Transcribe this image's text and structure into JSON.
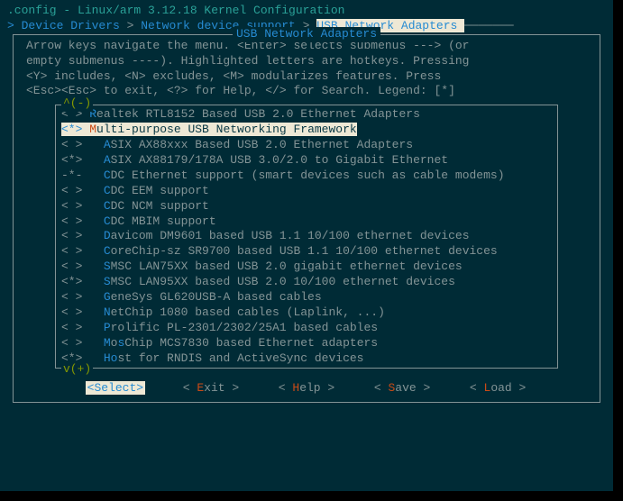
{
  "title": ".config - Linux/arm 3.12.18 Kernel Configuration",
  "breadcrumb": {
    "prefix": "> ",
    "p1": "Device Drivers",
    "p2": "Network device support",
    "p3": "USB Network Adapters",
    "sep": " > "
  },
  "box_title": "USB Network Adapters",
  "help": {
    "l1": "Arrow keys navigate the menu.  <Enter> selects submenus ---> (or",
    "l2": "empty submenus ----).  Highlighted letters are hotkeys.  Pressing",
    "l3": "<Y> includes, <N> excludes, <M> modularizes features.  Press",
    "l4": "<Esc><Esc> to exit, <?> for Help, </> for Search.  Legend: [*]"
  },
  "scroll": {
    "up": "^(-)",
    "down": "v(+)"
  },
  "items": [
    {
      "state": "< >",
      "hot": "R",
      "rest": "ealtek RTL8152 Based USB 2.0 Ethernet Adapters",
      "sel": false,
      "ind": 0
    },
    {
      "state": "<*>",
      "hot": "M",
      "rest": "ulti-purpose USB Networking Framework",
      "sel": true,
      "ind": 0
    },
    {
      "state": "< >",
      "hot": "A",
      "rest": "SIX AX88xxx Based USB 2.0 Ethernet Adapters",
      "sel": false,
      "ind": 1
    },
    {
      "state": "<*>",
      "hot": "A",
      "rest": "SIX AX88179/178A USB 3.0/2.0 to Gigabit Ethernet",
      "sel": false,
      "ind": 1
    },
    {
      "state": "-*-",
      "hot": "C",
      "rest": "DC Ethernet support (smart devices such as cable modems)",
      "sel": false,
      "ind": 1
    },
    {
      "state": "< >",
      "hot": "C",
      "rest": "DC EEM support",
      "sel": false,
      "ind": 1
    },
    {
      "state": "< >",
      "hot": "C",
      "rest": "DC NCM support",
      "sel": false,
      "ind": 1
    },
    {
      "state": "< >",
      "hot": "C",
      "rest": "DC MBIM support",
      "sel": false,
      "ind": 1
    },
    {
      "state": "< >",
      "hot": "D",
      "rest": "avicom DM9601 based USB 1.1 10/100 ethernet devices",
      "sel": false,
      "ind": 1
    },
    {
      "state": "< >",
      "hot": "C",
      "rest": "oreChip-sz SR9700 based USB 1.1 10/100 ethernet devices",
      "sel": false,
      "ind": 1
    },
    {
      "state": "< >",
      "hot": "S",
      "rest": "MSC LAN75XX based USB 2.0 gigabit ethernet devices",
      "sel": false,
      "ind": 1
    },
    {
      "state": "<*>",
      "hot": "S",
      "rest": "MSC LAN95XX based USB 2.0 10/100 ethernet devices",
      "sel": false,
      "ind": 1
    },
    {
      "state": "< >",
      "hot": "G",
      "rest": "eneSys GL620USB-A based cables",
      "sel": false,
      "ind": 1
    },
    {
      "state": "< >",
      "hot": "N",
      "rest": "etChip 1080 based cables (Laplink, ...)",
      "sel": false,
      "ind": 1
    },
    {
      "state": "< >",
      "hot": "P",
      "rest": "rolific PL-2301/2302/25A1 based cables",
      "sel": false,
      "ind": 1
    },
    {
      "state": "< >",
      "hot": "M",
      "rest": "osChip MCS7830 based Ethernet adapters",
      "sel": false,
      "ind": 1,
      "hl2": 1
    },
    {
      "state": "<*>",
      "hot": "H",
      "rest": "ost for RNDIS and ActiveSync devices",
      "sel": false,
      "ind": 1,
      "hl2": 0
    }
  ],
  "buttons": {
    "select": {
      "l": "<",
      "hot": "S",
      "rest": "elect>",
      "sel": true
    },
    "exit": {
      "l": "< ",
      "hot": "E",
      "rest": "xit >"
    },
    "help": {
      "l": "< ",
      "hot": "H",
      "rest": "elp >"
    },
    "save": {
      "l": "< ",
      "hot": "S",
      "rest": "ave >"
    },
    "load": {
      "l": "< ",
      "hot": "L",
      "rest": "oad >"
    }
  }
}
